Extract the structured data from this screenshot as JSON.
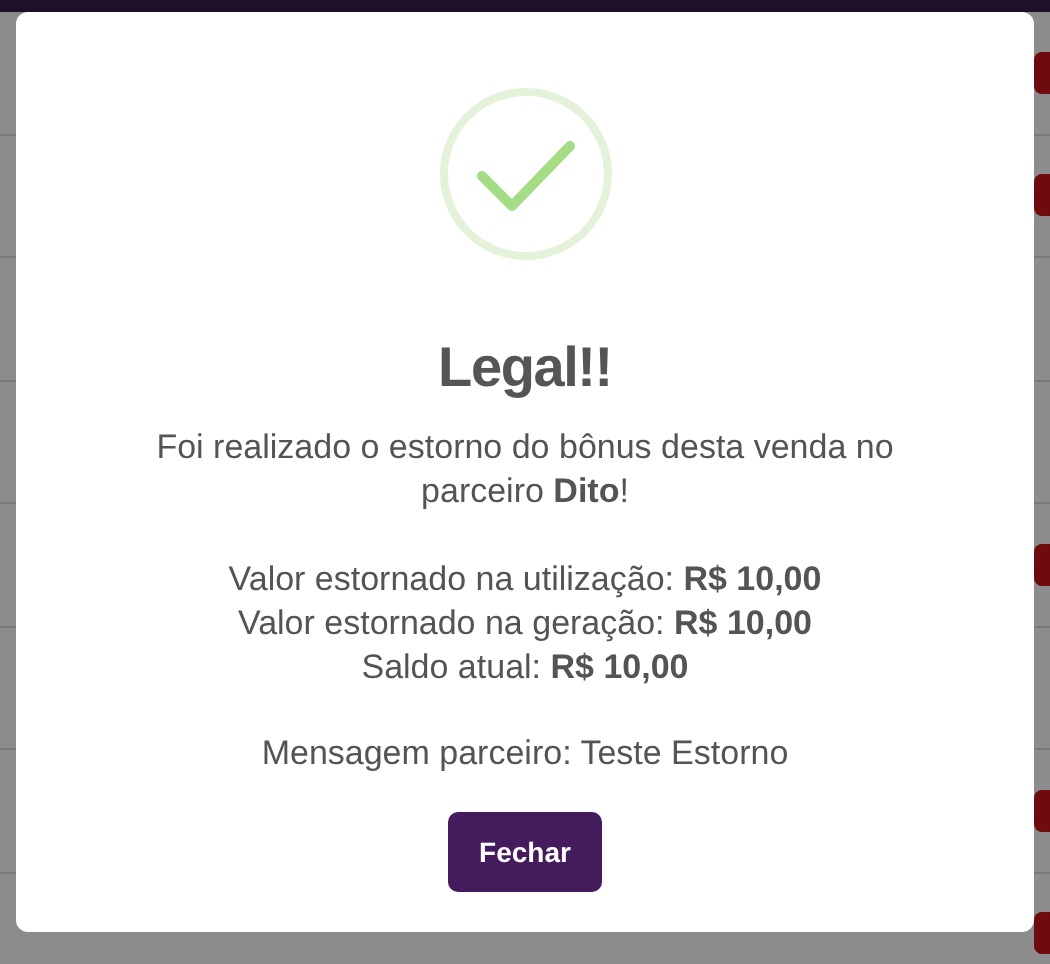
{
  "background_rows": [
    {
      "has_button": true
    },
    {
      "has_button": true
    },
    {
      "has_button": false
    },
    {
      "has_button": false
    },
    {
      "has_button": true
    },
    {
      "has_button": false
    },
    {
      "has_button": true
    },
    {
      "has_button": true
    }
  ],
  "dialog": {
    "title": "Legal!!",
    "message": "Foi realizado o estorno do bônus desta venda no parceiro **Dito**!",
    "details": [
      "Valor estornado na utilização: **R$ 10,00**",
      "Valor estornado na geração: **R$ 10,00**",
      "Saldo atual: **R$ 10,00**"
    ],
    "partner_message": "Mensagem parceiro: Teste Estorno",
    "button": "Fechar"
  }
}
